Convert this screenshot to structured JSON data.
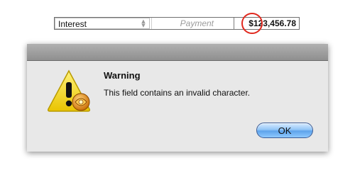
{
  "form_row": {
    "select_value": "Interest",
    "payment_placeholder": "Payment",
    "amount": "$123,456.78"
  },
  "dialog": {
    "title": "Warning",
    "message": "This field contains an invalid character.",
    "ok_label": "OK",
    "accent_color": "#5ea3eb"
  },
  "annotation": {
    "circle_color": "#e0281e"
  },
  "icons": {
    "warning": "warning-triangle-icon",
    "select_arrows": "updown-arrows-icon"
  }
}
